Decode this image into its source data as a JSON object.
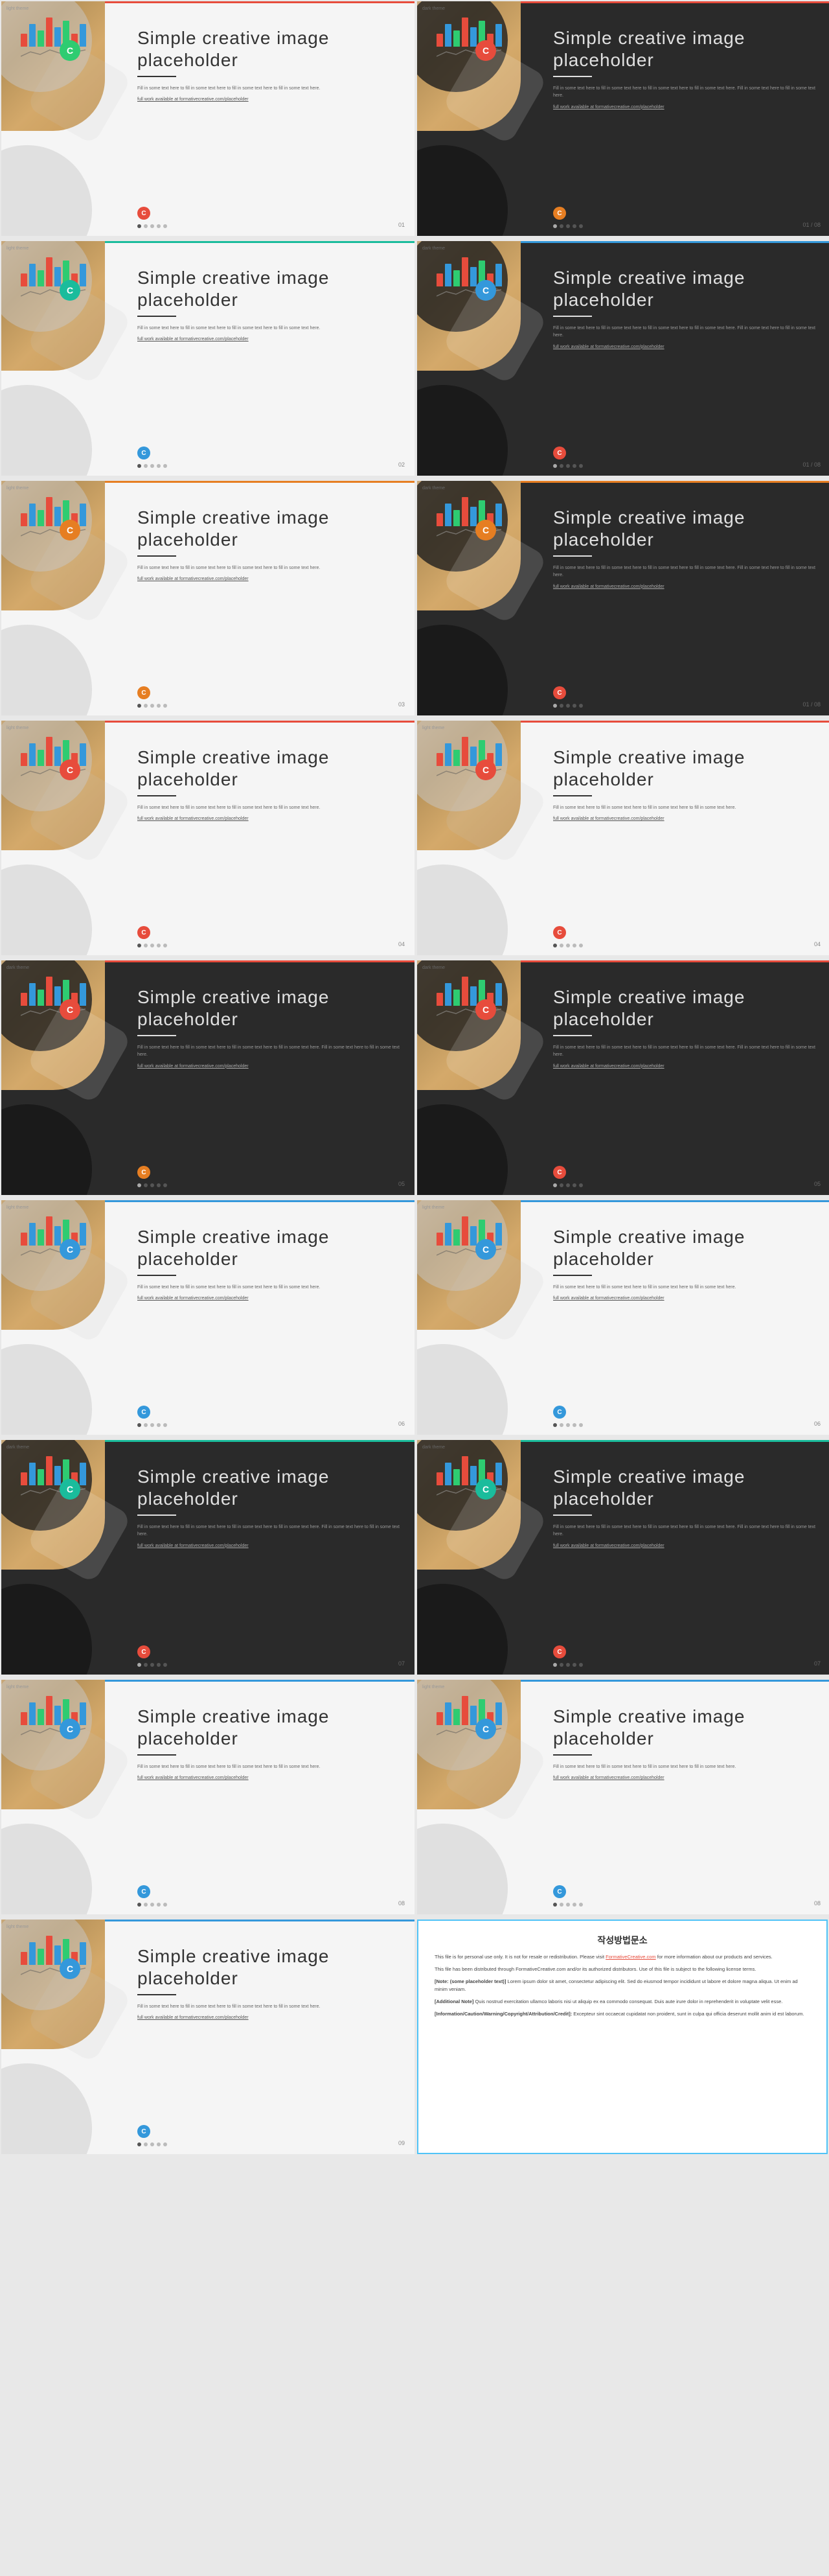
{
  "slides": [
    {
      "rows": [
        {
          "cards": [
            {
              "theme": "light",
              "badge_color": "#2ecc71",
              "badge_text": "C",
              "bar_heights": [
                20,
                35,
                25,
                45,
                30,
                40,
                20,
                35
              ],
              "bar_colors": [
                "#e74c3c",
                "#3498db",
                "#2ecc71",
                "#e74c3c",
                "#3498db",
                "#2ecc71",
                "#e74c3c",
                "#3498db"
              ],
              "title": "Simple creative image placeholder",
              "desc": "Fill in some text here to fill in some text here to fill in some text here to fill in some text here.",
              "link": "full work available at formativecreative.com/placeholder",
              "page": "01",
              "icon_color": "#e74c3c",
              "top_bar_color": "#e74c3c"
            },
            {
              "theme": "dark",
              "badge_color": "#e74c3c",
              "badge_text": "C",
              "bar_heights": [
                20,
                35,
                25,
                45,
                30,
                40,
                20,
                35
              ],
              "bar_colors": [
                "#e74c3c",
                "#3498db",
                "#2ecc71",
                "#e74c3c",
                "#3498db",
                "#2ecc71",
                "#e74c3c",
                "#3498db"
              ],
              "title": "Simple creative image placeholder",
              "desc": "Fill in some text here to fill in some text here to fill in some text here to fill in some text here. Fill in some text here to fill in some text here.",
              "link": "full work available at formativecreative.com/placeholder",
              "page": "01 / 08",
              "icon_color": "#e67e22",
              "top_bar_color": "#e74c3c"
            }
          ]
        },
        {
          "cards": [
            {
              "theme": "light",
              "badge_color": "#1abc9c",
              "badge_text": "C",
              "bar_heights": [
                20,
                35,
                25,
                45,
                30,
                40,
                20,
                35
              ],
              "bar_colors": [
                "#e74c3c",
                "#3498db",
                "#2ecc71",
                "#e74c3c",
                "#3498db",
                "#2ecc71",
                "#e74c3c",
                "#3498db"
              ],
              "title": "Simple creative image placeholder",
              "desc": "Fill in some text here to fill in some text here to fill in some text here to fill in some text here.",
              "link": "full work available at formativecreative.com/placeholder",
              "page": "02",
              "icon_color": "#3498db",
              "top_bar_color": "#1abc9c"
            },
            {
              "theme": "dark",
              "badge_color": "#3498db",
              "badge_text": "C",
              "bar_heights": [
                20,
                35,
                25,
                45,
                30,
                40,
                20,
                35
              ],
              "bar_colors": [
                "#e74c3c",
                "#3498db",
                "#2ecc71",
                "#e74c3c",
                "#3498db",
                "#2ecc71",
                "#e74c3c",
                "#3498db"
              ],
              "title": "Simple creative image placeholder",
              "desc": "Fill in some text here to fill in some text here to fill in some text here to fill in some text here. Fill in some text here to fill in some text here.",
              "link": "full work available at formativecreative.com/placeholder",
              "page": "01 / 08",
              "icon_color": "#e74c3c",
              "top_bar_color": "#3498db"
            }
          ]
        },
        {
          "cards": [
            {
              "theme": "light",
              "badge_color": "#e67e22",
              "badge_text": "C",
              "bar_heights": [
                20,
                35,
                25,
                45,
                30,
                40,
                20,
                35
              ],
              "bar_colors": [
                "#e74c3c",
                "#3498db",
                "#2ecc71",
                "#e74c3c",
                "#3498db",
                "#2ecc71",
                "#e74c3c",
                "#3498db"
              ],
              "title": "Simple creative image placeholder",
              "desc": "Fill in some text here to fill in some text here to fill in some text here to fill in some text here.",
              "link": "full work available at formativecreative.com/placeholder",
              "page": "03",
              "icon_color": "#e67e22",
              "top_bar_color": "#e67e22"
            },
            {
              "theme": "dark",
              "badge_color": "#e67e22",
              "badge_text": "C",
              "bar_heights": [
                20,
                35,
                25,
                45,
                30,
                40,
                20,
                35
              ],
              "bar_colors": [
                "#e74c3c",
                "#3498db",
                "#2ecc71",
                "#e74c3c",
                "#3498db",
                "#2ecc71",
                "#e74c3c",
                "#3498db"
              ],
              "title": "Simple creative image placeholder",
              "desc": "Fill in some text here to fill in some text here to fill in some text here to fill in some text here. Fill in some text here to fill in some text here.",
              "link": "full work available at formativecreative.com/placeholder",
              "page": "01 / 08",
              "icon_color": "#e74c3c",
              "top_bar_color": "#e67e22"
            }
          ]
        },
        {
          "cards": [
            {
              "theme": "light",
              "badge_color": "#e74c3c",
              "badge_text": "C",
              "bar_heights": [
                20,
                35,
                25,
                45,
                30,
                40,
                20,
                35
              ],
              "bar_colors": [
                "#e74c3c",
                "#3498db",
                "#2ecc71",
                "#e74c3c",
                "#3498db",
                "#2ecc71",
                "#e74c3c",
                "#3498db"
              ],
              "title": "Simple creative image placeholder",
              "desc": "Fill in some text here to fill in some text here to fill in some text here to fill in some text here.",
              "link": "full work available at formativecreative.com/placeholder",
              "page": "04",
              "icon_color": "#e74c3c",
              "top_bar_color": "#e74c3c"
            },
            {
              "theme": "light",
              "badge_color": "#e74c3c",
              "badge_text": "C",
              "bar_heights": [
                20,
                35,
                25,
                45,
                30,
                40,
                20,
                35
              ],
              "bar_colors": [
                "#e74c3c",
                "#3498db",
                "#2ecc71",
                "#e74c3c",
                "#3498db",
                "#2ecc71",
                "#e74c3c",
                "#3498db"
              ],
              "title": "Simple creative image placeholder",
              "desc": "Fill in some text here to fill in some text here to fill in some text here to fill in some text here.",
              "link": "full work available at formativecreative.com/placeholder",
              "page": "04",
              "icon_color": "#e74c3c",
              "top_bar_color": "#e74c3c"
            }
          ]
        },
        {
          "cards": [
            {
              "theme": "dark",
              "badge_color": "#e74c3c",
              "badge_text": "C",
              "bar_heights": [
                20,
                35,
                25,
                45,
                30,
                40,
                20,
                35
              ],
              "bar_colors": [
                "#e74c3c",
                "#3498db",
                "#2ecc71",
                "#e74c3c",
                "#3498db",
                "#2ecc71",
                "#e74c3c",
                "#3498db"
              ],
              "title": "Simple creative image placeholder",
              "desc": "Fill in some text here to fill in some text here to fill in some text here to fill in some text here. Fill in some text here to fill in some text here.",
              "link": "full work available at formativecreative.com/placeholder",
              "page": "05",
              "icon_color": "#e67e22",
              "top_bar_color": "#e74c3c"
            },
            {
              "theme": "dark",
              "badge_color": "#e74c3c",
              "badge_text": "C",
              "bar_heights": [
                20,
                35,
                25,
                45,
                30,
                40,
                20,
                35
              ],
              "bar_colors": [
                "#e74c3c",
                "#3498db",
                "#2ecc71",
                "#e74c3c",
                "#3498db",
                "#2ecc71",
                "#e74c3c",
                "#3498db"
              ],
              "title": "Simple creative image placeholder",
              "desc": "Fill in some text here to fill in some text here to fill in some text here to fill in some text here. Fill in some text here to fill in some text here.",
              "link": "full work available at formativecreative.com/placeholder",
              "page": "05",
              "icon_color": "#e74c3c",
              "top_bar_color": "#e74c3c"
            }
          ]
        },
        {
          "cards": [
            {
              "theme": "light",
              "badge_color": "#3498db",
              "badge_text": "C",
              "bar_heights": [
                20,
                35,
                25,
                45,
                30,
                40,
                20,
                35
              ],
              "bar_colors": [
                "#e74c3c",
                "#3498db",
                "#2ecc71",
                "#e74c3c",
                "#3498db",
                "#2ecc71",
                "#e74c3c",
                "#3498db"
              ],
              "title": "Simple creative image placeholder",
              "desc": "Fill in some text here to fill in some text here to fill in some text here to fill in some text here.",
              "link": "full work available at formativecreative.com/placeholder",
              "page": "06",
              "icon_color": "#3498db",
              "top_bar_color": "#3498db"
            },
            {
              "theme": "light",
              "badge_color": "#3498db",
              "badge_text": "C",
              "bar_heights": [
                20,
                35,
                25,
                45,
                30,
                40,
                20,
                35
              ],
              "bar_colors": [
                "#e74c3c",
                "#3498db",
                "#2ecc71",
                "#e74c3c",
                "#3498db",
                "#2ecc71",
                "#e74c3c",
                "#3498db"
              ],
              "title": "Simple creative image placeholder",
              "desc": "Fill in some text here to fill in some text here to fill in some text here to fill in some text here.",
              "link": "full work available at formativecreative.com/placeholder",
              "page": "06",
              "icon_color": "#3498db",
              "top_bar_color": "#3498db"
            }
          ]
        },
        {
          "cards": [
            {
              "theme": "dark",
              "badge_color": "#1abc9c",
              "badge_text": "C",
              "bar_heights": [
                20,
                35,
                25,
                45,
                30,
                40,
                20,
                35
              ],
              "bar_colors": [
                "#e74c3c",
                "#3498db",
                "#2ecc71",
                "#e74c3c",
                "#3498db",
                "#2ecc71",
                "#e74c3c",
                "#3498db"
              ],
              "title": "Simple creative image placeholder",
              "desc": "Fill in some text here to fill in some text here to fill in some text here to fill in some text here. Fill in some text here to fill in some text here.",
              "link": "full work available at formativecreative.com/placeholder",
              "page": "07",
              "icon_color": "#e74c3c",
              "top_bar_color": "#1abc9c"
            },
            {
              "theme": "dark",
              "badge_color": "#1abc9c",
              "badge_text": "C",
              "bar_heights": [
                20,
                35,
                25,
                45,
                30,
                40,
                20,
                35
              ],
              "bar_colors": [
                "#e74c3c",
                "#3498db",
                "#2ecc71",
                "#e74c3c",
                "#3498db",
                "#2ecc71",
                "#e74c3c",
                "#3498db"
              ],
              "title": "Simple creative image placeholder",
              "desc": "Fill in some text here to fill in some text here to fill in some text here to fill in some text here. Fill in some text here to fill in some text here.",
              "link": "full work available at formativecreative.com/placeholder",
              "page": "07",
              "icon_color": "#e74c3c",
              "top_bar_color": "#1abc9c"
            }
          ]
        },
        {
          "cards": [
            {
              "theme": "light",
              "badge_color": "#3498db",
              "badge_text": "C",
              "bar_heights": [
                20,
                35,
                25,
                45,
                30,
                40,
                20,
                35
              ],
              "bar_colors": [
                "#e74c3c",
                "#3498db",
                "#2ecc71",
                "#e74c3c",
                "#3498db",
                "#2ecc71",
                "#e74c3c",
                "#3498db"
              ],
              "title": "Simple creative image placeholder",
              "desc": "Fill in some text here to fill in some text here to fill in some text here to fill in some text here.",
              "link": "full work available at formativecreative.com/placeholder",
              "page": "08",
              "icon_color": "#3498db",
              "top_bar_color": "#3498db"
            },
            {
              "theme": "light",
              "badge_color": "#3498db",
              "badge_text": "C",
              "bar_heights": [
                20,
                35,
                25,
                45,
                30,
                40,
                20,
                35
              ],
              "bar_colors": [
                "#e74c3c",
                "#3498db",
                "#2ecc71",
                "#e74c3c",
                "#3498db",
                "#2ecc71",
                "#e74c3c",
                "#3498db"
              ],
              "title": "Simple creative image placeholder",
              "desc": "Fill in some text here to fill in some text here to fill in some text here to fill in some text here.",
              "link": "full work available at formativecreative.com/placeholder",
              "page": "08",
              "icon_color": "#3498db",
              "top_bar_color": "#3498db"
            }
          ]
        },
        {
          "cards": [
            {
              "theme": "light",
              "badge_color": "#3498db",
              "badge_text": "C",
              "bar_heights": [
                20,
                35,
                25,
                45,
                30,
                40,
                20,
                35
              ],
              "bar_colors": [
                "#e74c3c",
                "#3498db",
                "#2ecc71",
                "#e74c3c",
                "#3498db",
                "#2ecc71",
                "#e74c3c",
                "#3498db"
              ],
              "title": "Simple creative image placeholder",
              "desc": "Fill in some text here to fill in some text here to fill in some text here to fill in some text here.",
              "link": "full work available at formativecreative.com/placeholder",
              "page": "09",
              "icon_color": "#3498db",
              "top_bar_color": "#3498db"
            },
            {
              "type": "text",
              "title": "작성방법문소",
              "content": "This file is for personal use only. It is not for resale or redistribution. Please visit FormativeCreative.com for more information about our products and services.\n\nThis file has been distributed through FormativeCreative.com and/or its authorized distributors. Use of this file is subject to the following license terms.\n\n[Note: (some placeholder text)]  Lorem ipsum dolor sit amet, consectetur adipiscing elit. Sed do eiusmod tempor incididunt ut labore et dolore magna aliqua. Ut enim ad minim veniam.\n\n[Additional Note] Quis nostrud exercitation ullamco laboris nisi ut aliquip ex ea commodo consequat. Duis aute irure dolor in reprehenderit in voluptate velit esse.\n\n[Information/Caution/Warning/Copyright/Attribution/Credit]: Excepteur sint occaecat cupidatat non proident, sunt in culpa qui officia deserunt mollit anim id est laborum."
            }
          ]
        }
      ]
    }
  ],
  "placeholderText": "Simple creative image placeholder",
  "descText": "Fill in some text here to fill in some text here to fill in some text here to fill in some text here.",
  "linkText": "full work available at formativecreative.com/placeholder"
}
